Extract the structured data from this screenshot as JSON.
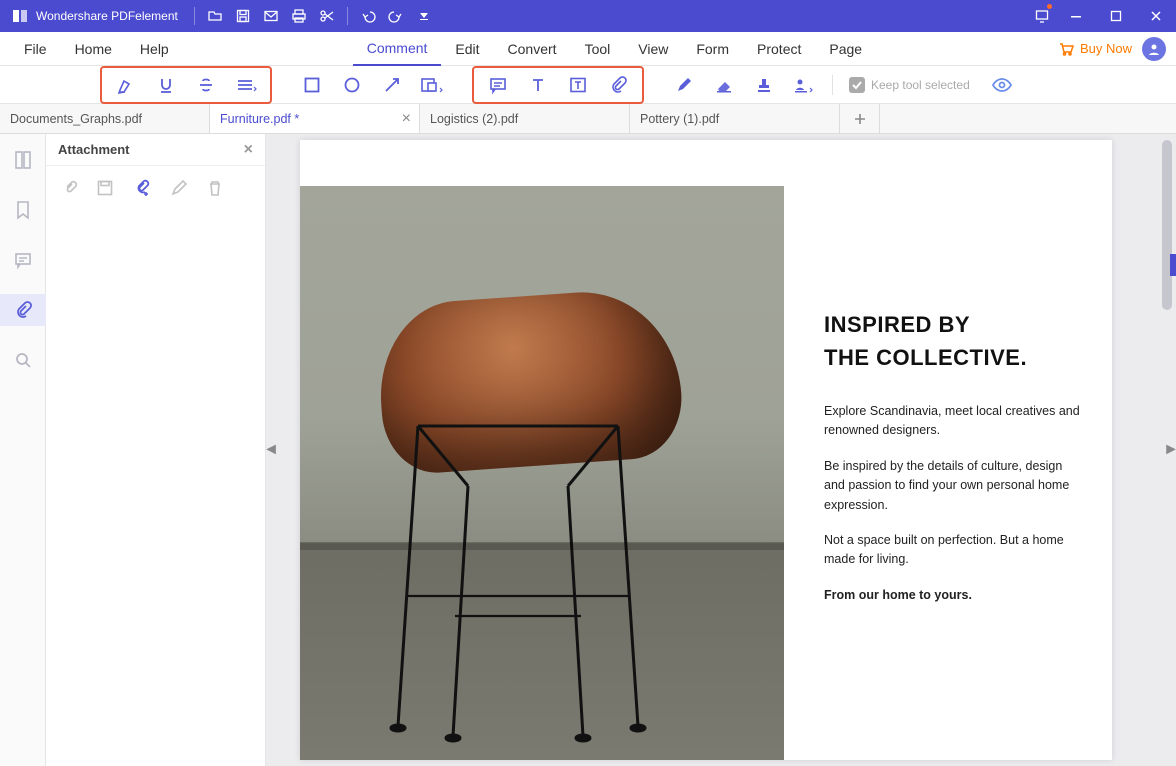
{
  "app": {
    "title": "Wondershare PDFelement"
  },
  "menus": {
    "file": "File",
    "home": "Home",
    "help": "Help",
    "comment": "Comment",
    "edit": "Edit",
    "convert": "Convert",
    "tool": "Tool",
    "view": "View",
    "form": "Form",
    "protect": "Protect",
    "page": "Page"
  },
  "active_menu": "comment",
  "buy_now": "Buy Now",
  "toolbar": {
    "keep_label": "Keep tool selected"
  },
  "tabs": [
    {
      "label": "Documents_Graphs.pdf",
      "active": false,
      "closeable": false
    },
    {
      "label": "Furniture.pdf *",
      "active": true,
      "closeable": true
    },
    {
      "label": "Logistics (2).pdf",
      "active": false,
      "closeable": false
    },
    {
      "label": "Pottery (1).pdf",
      "active": false,
      "closeable": false
    }
  ],
  "sidepanel": {
    "title": "Attachment"
  },
  "document": {
    "heading_line1": "INSPIRED BY",
    "heading_line2": "THE COLLECTIVE.",
    "p1": "Explore Scandinavia, meet local creatives and renowned designers.",
    "p2": "Be inspired by the details of culture, design and passion to find your own personal home expression.",
    "p3": "Not a space built on perfection. But a home made for living.",
    "p4": "From our home to yours."
  }
}
